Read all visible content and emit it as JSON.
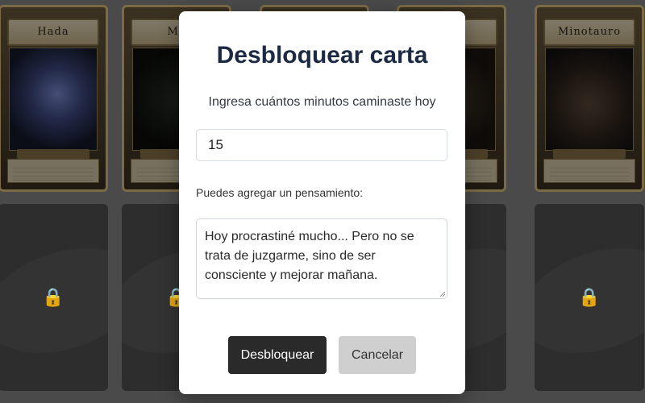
{
  "background_cards": {
    "top_row": [
      {
        "title": "Hada"
      },
      {
        "title": "Me"
      },
      {
        "title": ""
      },
      {
        "title": "ken"
      },
      {
        "title": "Minotauro"
      }
    ],
    "bottom_row_lock_icon": "🔒"
  },
  "modal": {
    "title": "Desbloquear carta",
    "subtitle": "Ingresa cuántos minutos caminaste hoy",
    "minutes_value": "15",
    "thought_label": "Puedes agregar un pensamiento:",
    "thought_value": "Hoy procrastiné mucho... Pero no se trata de juzgarme, sino de ser consciente y mejorar mañana.",
    "unlock_button": "Desbloquear",
    "cancel_button": "Cancelar"
  },
  "colors": {
    "modal_title": "#1c2a44",
    "primary_button": "#2a2a2a",
    "secondary_button": "#cfcfcf"
  }
}
